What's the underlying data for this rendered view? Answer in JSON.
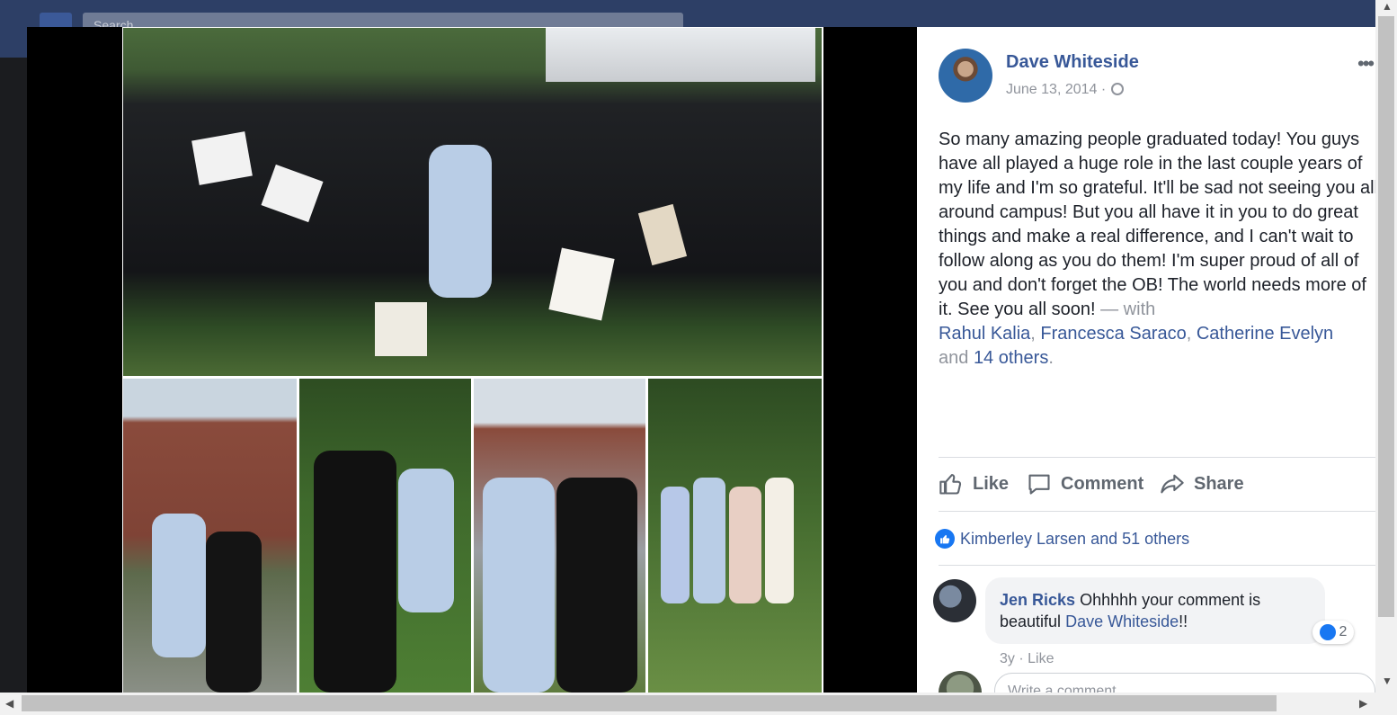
{
  "topbar": {
    "search_placeholder": "Search"
  },
  "post": {
    "author": "Dave Whiteside",
    "date": "June 13, 2014",
    "more_label": "•••",
    "text": "So many amazing people graduated today! You guys have all played a huge role in the last couple years of my life and I'm so grateful. It'll be sad not seeing you all around campus! But you all have it in you to do great things and make a real difference, and I can't wait to follow along as you do them! I'm super proud of all of you and don't forget the OB! The world needs more of it. See you all soon!",
    "with_label": " — with",
    "tags": [
      "Rahul Kalia",
      "Francesca Saraco",
      "Catherine Evelyn"
    ],
    "sep_comma": ",",
    "and_label": "and",
    "others_link": "14 others",
    "period": "."
  },
  "actions": {
    "like": "Like",
    "comment": "Comment",
    "share": "Share"
  },
  "reactions": {
    "summary": "Kimberley Larsen and 51 others"
  },
  "comment": {
    "author": "Jen Ricks",
    "text_before": "Ohhhhh your comment is beautiful",
    "link": "Dave Whiteside",
    "text_after": "!!",
    "reaction_count": "2",
    "age": "3y",
    "like_label": "Like"
  },
  "composer": {
    "placeholder": "Write a comment..."
  },
  "colors": {
    "link": "#385898",
    "like_blue": "#1877f2",
    "text": "#1d2129",
    "muted": "#90949c"
  }
}
